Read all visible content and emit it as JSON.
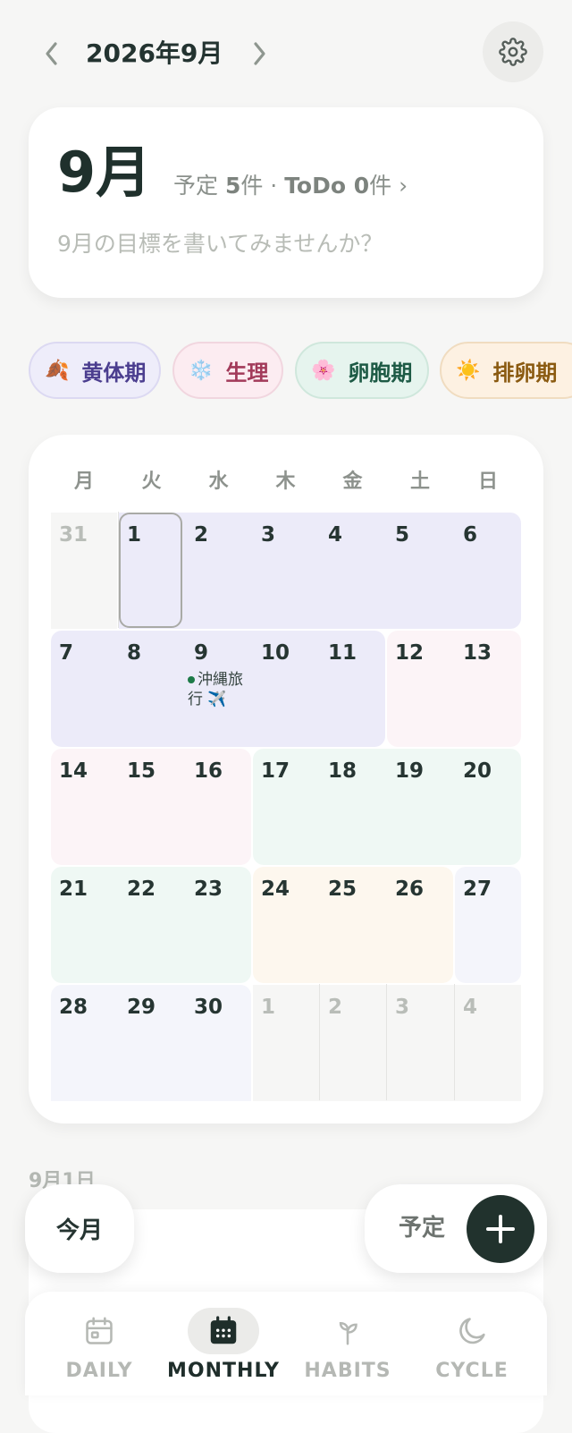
{
  "header": {
    "title": "2026年9月",
    "prev_icon": "chevron-left",
    "next_icon": "chevron-right",
    "settings_icon": "gear"
  },
  "summary": {
    "month_label": "9月",
    "stats_prefix_1": "予定 ",
    "events_count": "5",
    "stats_mid": "件 · ",
    "todo_label": "ToDo ",
    "todo_count": "0",
    "stats_suffix": "件 ›",
    "goal_placeholder": "9月の目標を書いてみませんか？"
  },
  "phases": [
    {
      "icon": "🍂",
      "label": "黄体期",
      "color": "#4b3e8f",
      "bg": "#eeedfa",
      "border": "#dcd9f2"
    },
    {
      "icon": "❄️",
      "label": "生理",
      "color": "#a23a5a",
      "bg": "#fcecf1",
      "border": "#f1d6df"
    },
    {
      "icon": "🌸",
      "label": "卵胞期",
      "color": "#1d5a45",
      "bg": "#e6f4ee",
      "border": "#cfe7dc"
    },
    {
      "icon": "☀️",
      "label": "排卵期",
      "color": "#8a5a10",
      "bg": "#fdf1e2",
      "border": "#f0dcc0"
    }
  ],
  "calendar": {
    "weekdays": [
      "月",
      "火",
      "水",
      "木",
      "金",
      "土",
      "日"
    ],
    "weeks": [
      [
        "31",
        "1",
        "2",
        "3",
        "4",
        "5",
        "6"
      ],
      [
        "7",
        "8",
        "9",
        "10",
        "11",
        "12",
        "13"
      ],
      [
        "14",
        "15",
        "16",
        "17",
        "18",
        "19",
        "20"
      ],
      [
        "21",
        "22",
        "23",
        "24",
        "25",
        "26",
        "27"
      ],
      [
        "28",
        "29",
        "30",
        "1",
        "2",
        "3",
        "4"
      ]
    ],
    "event": {
      "day": "9",
      "text": "沖縄旅行 ✈️",
      "color": "#1d7a48"
    }
  },
  "day_section": {
    "label": "9月1日"
  },
  "fab": {
    "this_month": "今月",
    "add_label": "予定",
    "add_icon": "plus"
  },
  "nav": [
    {
      "label": "DAILY",
      "icon": "calendar-outline",
      "active": false
    },
    {
      "label": "MONTHLY",
      "icon": "calendar-grid",
      "active": true
    },
    {
      "label": "HABITS",
      "icon": "sprout",
      "active": false
    },
    {
      "label": "CYCLE",
      "icon": "moon",
      "active": false
    }
  ]
}
